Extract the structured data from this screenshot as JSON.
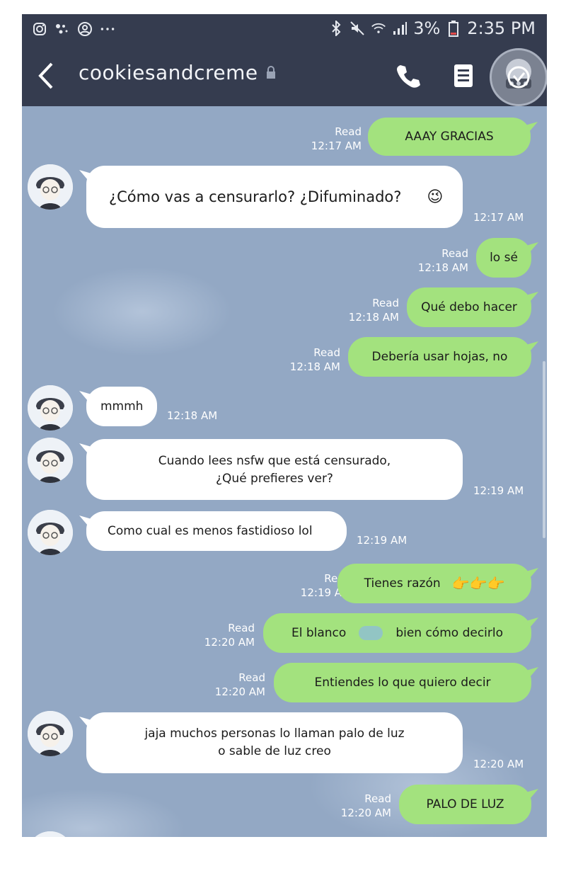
{
  "status_bar": {
    "battery": "3%",
    "time": "2:35 PM",
    "icons": [
      "instagram-icon",
      "dots-icon",
      "face-icon",
      "more-icon",
      "bluetooth-icon",
      "mute-icon",
      "wifi-icon",
      "signal-icon",
      "battery-icon"
    ]
  },
  "header": {
    "chat_name": "cookiesandcreme",
    "icons": [
      "back-icon",
      "lock-icon",
      "phone-icon",
      "menu-icon",
      "profile-avatar"
    ]
  },
  "messages": [
    {
      "dir": "out",
      "text": "AAAY GRACIAS",
      "read": "Read",
      "time": "12:17 AM"
    },
    {
      "dir": "in",
      "text": "¿Cómo vas a censurarlo? ¿Difuminado?",
      "emoji": "😉",
      "time": "12:17 AM"
    },
    {
      "dir": "out",
      "text": "lo sé",
      "read": "Read",
      "time": "12:18 AM"
    },
    {
      "dir": "out",
      "text": "Qué debo hacer",
      "read": "Read",
      "time": "12:18 AM"
    },
    {
      "dir": "out",
      "text": "Debería usar hojas, no",
      "read": "Read",
      "time": "12:18 AM"
    },
    {
      "dir": "in",
      "text": "mmmh",
      "time": "12:18 AM"
    },
    {
      "dir": "in",
      "line1": "Cuando lees nsfw que está censurado,",
      "line2": "¿Qué prefieres ver?",
      "time": "12:19 AM"
    },
    {
      "dir": "in",
      "text": "Como cual es menos fastidioso lol",
      "time": "12:19 AM"
    },
    {
      "dir": "out",
      "text": "Tienes razón",
      "emoji": "👉👉👉",
      "read": "Read",
      "time": "12:19 AM"
    },
    {
      "dir": "out",
      "text_a": "El blanco",
      "text_b": "bien cómo decirlo",
      "read": "Read",
      "time": "12:20 AM"
    },
    {
      "dir": "out",
      "text": "Entiendes lo que quiero decir",
      "read": "Read",
      "time": "12:20 AM"
    },
    {
      "dir": "in",
      "line1": "jaja muchos personas lo llaman palo de luz",
      "line2": "o sable de luz creo",
      "time": "12:20 AM"
    },
    {
      "dir": "out",
      "text": "PALO DE LUZ",
      "read": "Read",
      "time": "12:20 AM"
    }
  ],
  "colors": {
    "header_bg": "#353c4f",
    "chat_bg": "#93a8c4",
    "outgoing_bubble": "#a3e27e",
    "incoming_bubble": "#ffffff"
  }
}
